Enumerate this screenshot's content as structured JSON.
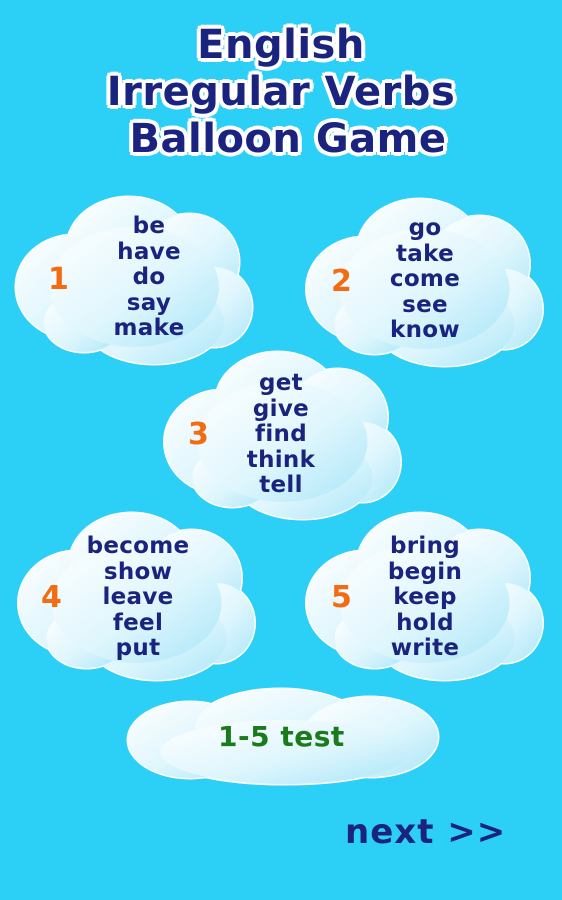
{
  "title": {
    "line1": "English",
    "line2": "Irregular Verbs",
    "line3": "Balloon Game"
  },
  "colors": {
    "background": "#2ccff6",
    "title_text": "#1a237e",
    "number": "#f36c12",
    "words": "#1a237e",
    "test": "#1b7a1b",
    "cloud_fill": "#c9f0fb"
  },
  "clouds": [
    {
      "number": "1",
      "words": [
        "be",
        "have",
        "do",
        "say",
        "make"
      ]
    },
    {
      "number": "2",
      "words": [
        "go",
        "take",
        "come",
        "see",
        "know"
      ]
    },
    {
      "number": "3",
      "words": [
        "get",
        "give",
        "find",
        "think",
        "tell"
      ]
    },
    {
      "number": "4",
      "words": [
        "become",
        "show",
        "leave",
        "feel",
        "put"
      ]
    },
    {
      "number": "5",
      "words": [
        "bring",
        "begin",
        "keep",
        "hold",
        "write"
      ]
    }
  ],
  "test_button": {
    "label": "1-5 test"
  },
  "next_button": {
    "label": "next >>"
  }
}
